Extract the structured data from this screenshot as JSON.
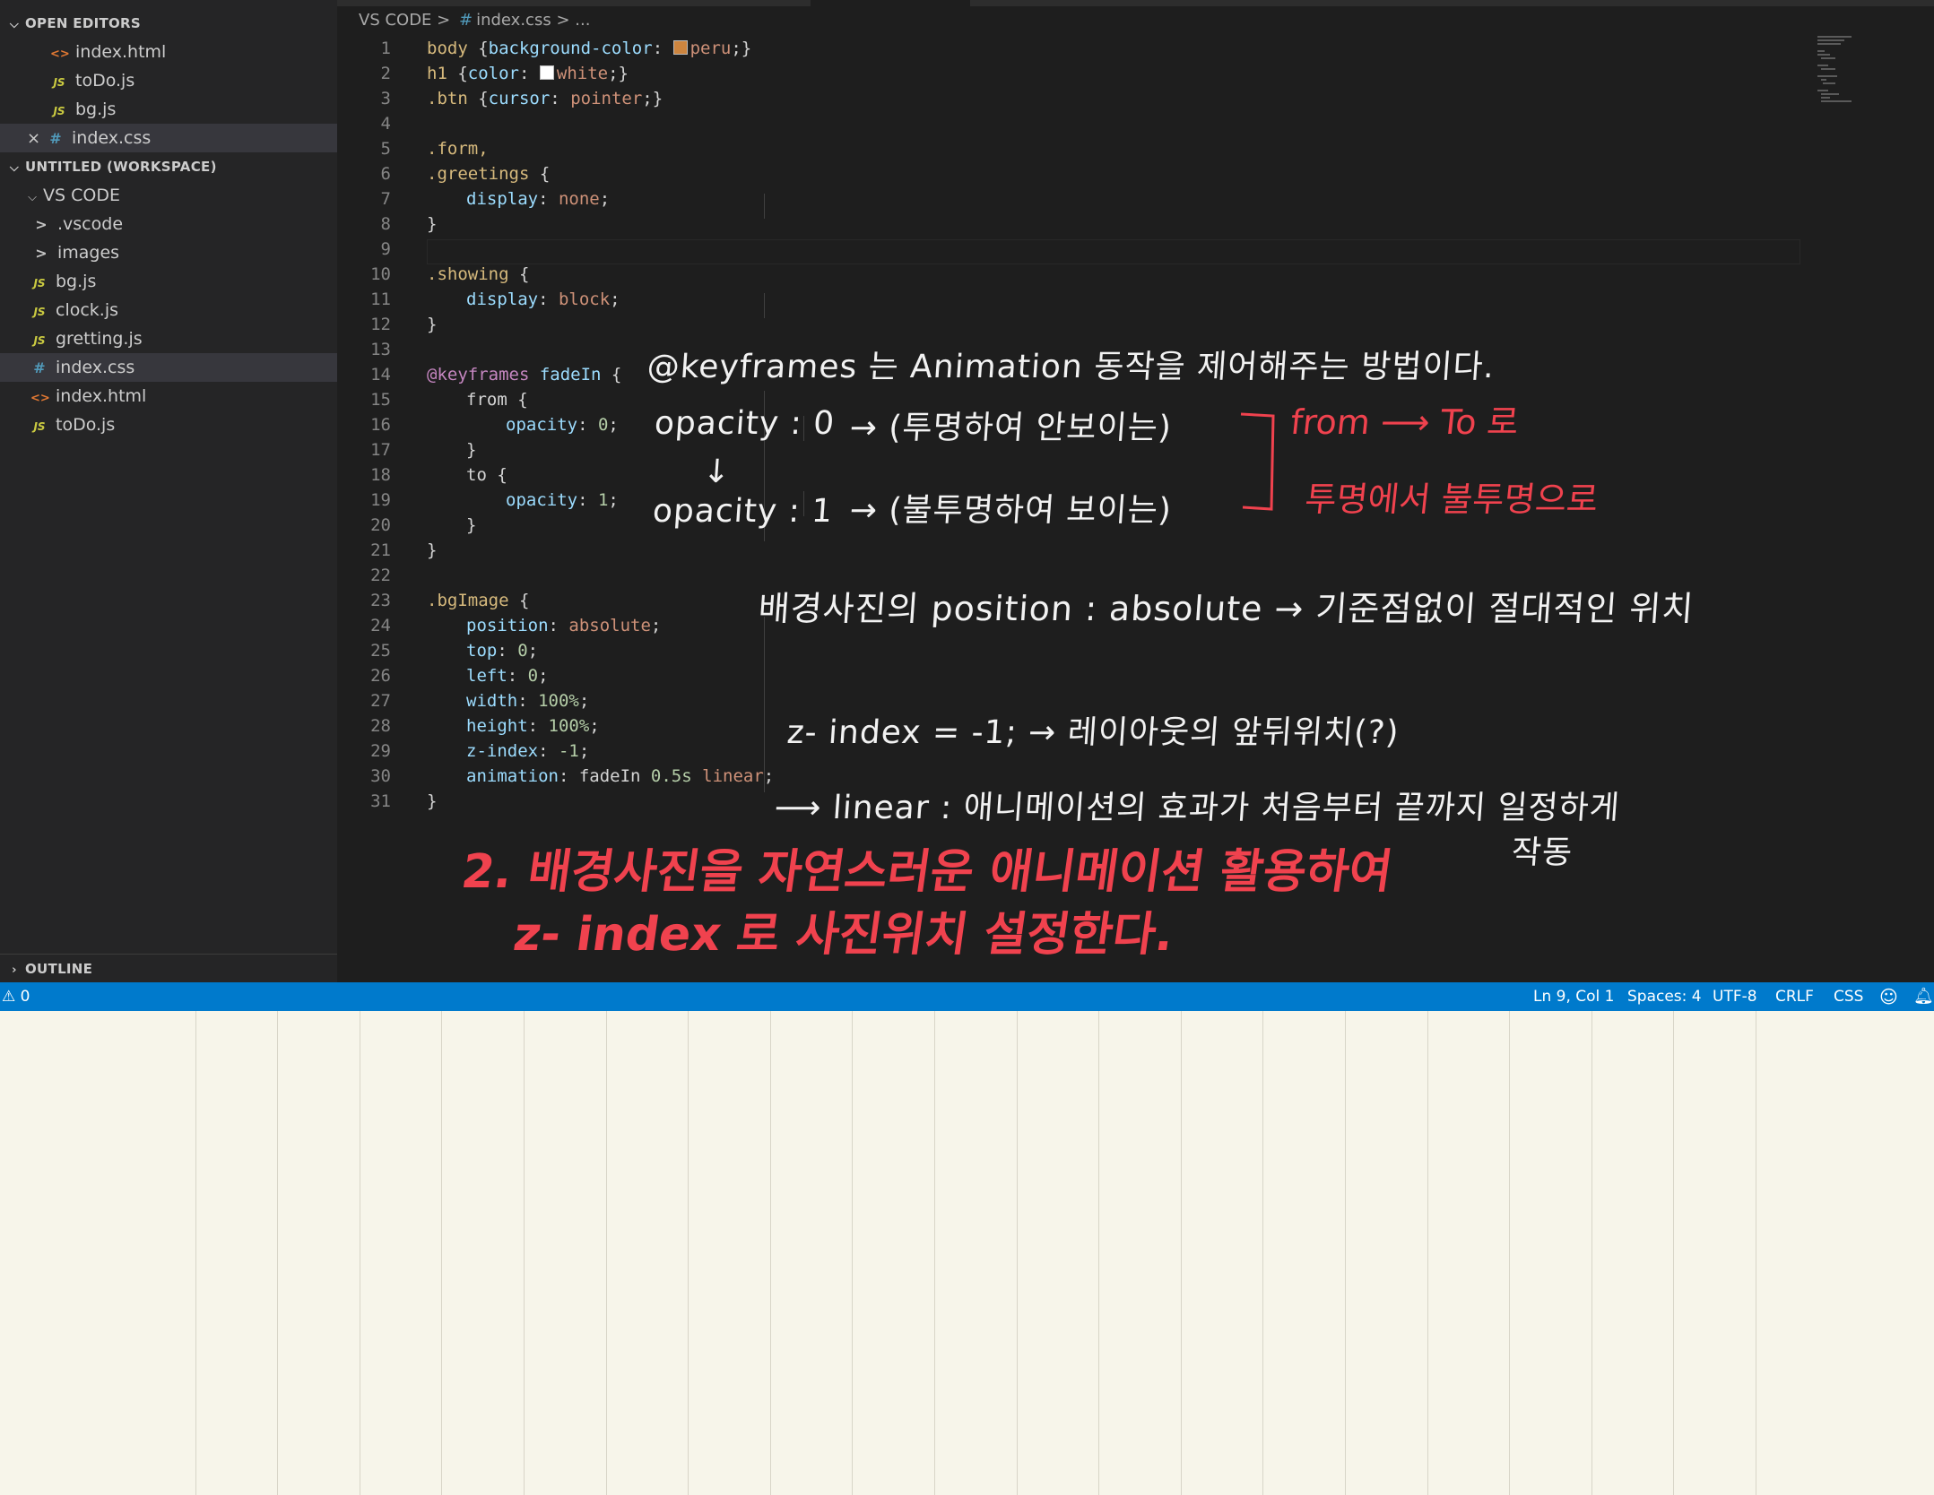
{
  "sidebar": {
    "open_editors_label": "OPEN EDITORS",
    "open_editors": [
      {
        "icon": "<>",
        "label": "index.html"
      },
      {
        "icon": "JS",
        "label": "toDo.js"
      },
      {
        "icon": "JS",
        "label": "bg.js"
      },
      {
        "icon": "#",
        "label": "index.css",
        "close": "×"
      }
    ],
    "workspace_label": "UNTITLED (WORKSPACE)",
    "folder_label": "VS CODE",
    "folders": [
      {
        "icon": ">",
        "label": ".vscode"
      },
      {
        "icon": ">",
        "label": "images"
      }
    ],
    "files": [
      {
        "icon": "JS",
        "label": "bg.js"
      },
      {
        "icon": "JS",
        "label": "clock.js"
      },
      {
        "icon": "JS",
        "label": "gretting.js"
      },
      {
        "icon": "#",
        "label": "index.css"
      },
      {
        "icon": "<>",
        "label": "index.html"
      },
      {
        "icon": "JS",
        "label": "toDo.js"
      }
    ],
    "outline_label": "OUTLINE"
  },
  "breadcrumb": {
    "root": "VS CODE",
    "sep": ">",
    "hash": "#",
    "file": "index.css",
    "more": "> ..."
  },
  "code": {
    "line_numbers": [
      "1",
      "2",
      "3",
      "4",
      "5",
      "6",
      "7",
      "8",
      "9",
      "10",
      "11",
      "12",
      "13",
      "14",
      "15",
      "16",
      "17",
      "18",
      "19",
      "20",
      "21",
      "22",
      "23",
      "24",
      "25",
      "26",
      "27",
      "28",
      "29",
      "30",
      "31"
    ],
    "l1": {
      "sel": "body",
      "p1": " {",
      "prop": "background-color",
      "p2": ": ",
      "val": "peru",
      "p3": ";}"
    },
    "l2": {
      "sel": "h1",
      "p1": " {",
      "prop": "color",
      "p2": ": ",
      "val": "white",
      "p3": ";}"
    },
    "l3": {
      "sel": ".btn",
      "p1": " {",
      "prop": "cursor",
      "p2": ": ",
      "val": "pointer",
      "p3": ";}"
    },
    "l5": ".form,",
    "l6": {
      "sel": ".greetings",
      "p": " {"
    },
    "l7": {
      "prop": "display",
      "p": ": ",
      "val": "none",
      "end": ";"
    },
    "l8": "}",
    "l10": {
      "sel": ".showing",
      "p": " {"
    },
    "l11": {
      "prop": "display",
      "p": ": ",
      "val": "block",
      "end": ";"
    },
    "l12": "}",
    "l14": {
      "at": "@keyframes",
      "name": " fadeIn",
      "p": " {"
    },
    "l15": "from {",
    "l16": {
      "prop": "opacity",
      "p": ": ",
      "val": "0",
      "end": ";"
    },
    "l17": "}",
    "l18": "to {",
    "l19": {
      "prop": "opacity",
      "p": ": ",
      "val": "1",
      "end": ";"
    },
    "l20": "}",
    "l21": "}",
    "l23": {
      "sel": ".bgImage",
      "p": " {"
    },
    "l24": {
      "prop": "position",
      "p": ": ",
      "val": "absolute",
      "end": ";"
    },
    "l25": {
      "prop": "top",
      "p": ": ",
      "val": "0",
      "end": ";"
    },
    "l26": {
      "prop": "left",
      "p": ": ",
      "val": "0",
      "end": ";"
    },
    "l27": {
      "prop": "width",
      "p": ": ",
      "val": "100%",
      "end": ";"
    },
    "l28": {
      "prop": "height",
      "p": ": ",
      "val": "100%",
      "end": ";"
    },
    "l29": {
      "prop": "z-index",
      "p": ": ",
      "val": "-1",
      "end": ";"
    },
    "l30": {
      "prop": "animation",
      "p": ": ",
      "name": "fadeIn",
      "val1": " 0.5s",
      "val2": " linear",
      "end": ";"
    },
    "l31": "}"
  },
  "colors": {
    "peru": "#cd853f",
    "white": "#ffffff",
    "annotation_red": "#f0424e",
    "status_bar": "#007acc"
  },
  "annotations": {
    "a1": "@keyframes 는  Animation 동작을  제어해주는  방법이다.",
    "a2a": "opacity : 0",
    "a2b": "→  (투명하여  안보이는)",
    "a3": "↓",
    "a4a": "opacity : 1",
    "a4b": "→ (불투명하여  보이는)",
    "a5": "from  ⟶  To  로",
    "a6": "투명에서   불투명으로",
    "a7": "배경사진의  position :  absolute  → 기준점없이  절대적인 위치",
    "a8": "z- index = -1;  → 레이아웃의  앞뒤위치(?)",
    "a9": "⟶  linear : 애니메이션의  효과가  처음부터  끝까지  일정하게",
    "a10": "작동",
    "a11": "2.  배경사진을  자연스러운  애니메이션  활용하여",
    "a12": "z- index 로  사진위치  설정한다."
  },
  "status": {
    "problems": "⚠ 0",
    "position": "Ln 9, Col 1",
    "spaces": "Spaces: 4",
    "encoding": "UTF-8",
    "eol": "CRLF",
    "language": "CSS",
    "feedback_icon": "smiley-icon",
    "bell_icon": "bell-icon"
  }
}
